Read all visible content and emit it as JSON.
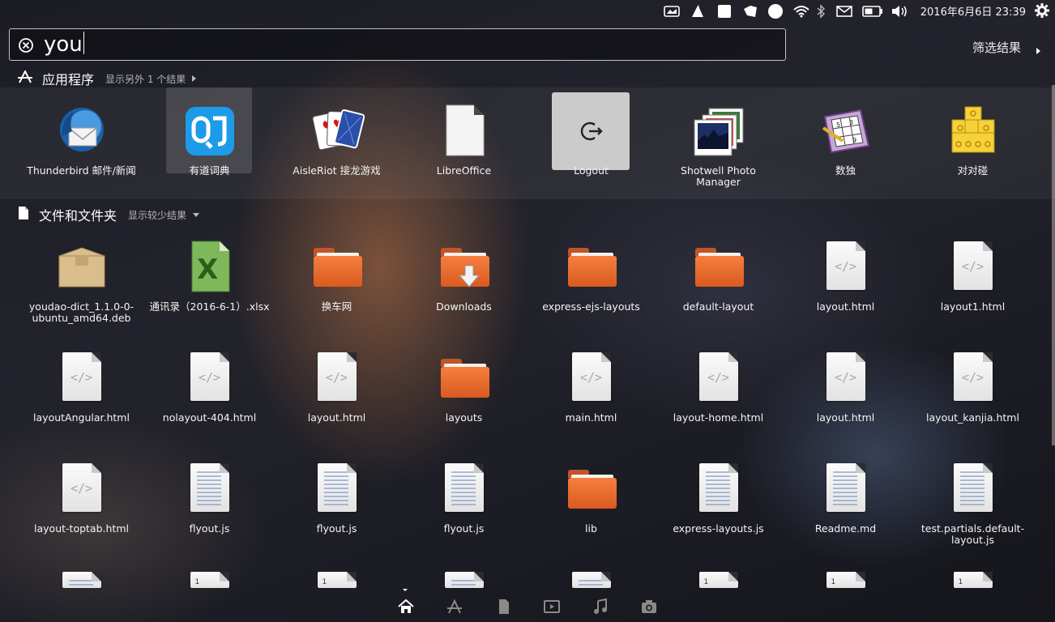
{
  "panel": {
    "clock": "2016年6月6日 23:39",
    "tray_icons": [
      "keyboard-indicator-icon",
      "app-indicator-icon",
      "app-indicator-2-icon",
      "app-indicator-3-icon",
      "circle-indicator-icon",
      "wifi-icon",
      "bluetooth-icon",
      "mail-icon",
      "battery-icon",
      "volume-icon"
    ]
  },
  "search": {
    "query": "you",
    "filter_label": "筛选结果"
  },
  "apps": {
    "title": "应用程序",
    "more": "显示另外 1 个结果",
    "items": [
      {
        "label": "Thunderbird 邮件/新闻",
        "icon": "thunderbird-icon"
      },
      {
        "label": "有道词典",
        "icon": "youdao-dict-icon"
      },
      {
        "label": "AisleRiot 接龙游戏",
        "icon": "aisleriot-cards-icon"
      },
      {
        "label": "LibreOffice",
        "icon": "libreoffice-icon"
      },
      {
        "label": "Logout",
        "icon": "logout-icon"
      },
      {
        "label": "Shotwell Photo Manager",
        "icon": "shotwell-icon"
      },
      {
        "label": "数独",
        "icon": "sudoku-icon"
      },
      {
        "label": "对对碰",
        "icon": "mahjongg-icon"
      }
    ]
  },
  "files": {
    "title": "文件和文件夹",
    "more": "显示较少结果",
    "items": [
      {
        "label": "youdao-dict_1.1.0-0-ubuntu_amd64.deb",
        "type": "package"
      },
      {
        "label": "通讯录（2016-6-1）.xlsx",
        "type": "spreadsheet"
      },
      {
        "label": "换车网",
        "type": "folder"
      },
      {
        "label": "Downloads",
        "type": "downloads-folder"
      },
      {
        "label": "express-ejs-layouts",
        "type": "folder"
      },
      {
        "label": "default-layout",
        "type": "folder"
      },
      {
        "label": "layout.html",
        "type": "html"
      },
      {
        "label": "layout1.html",
        "type": "html"
      },
      {
        "label": "layoutAngular.html",
        "type": "html"
      },
      {
        "label": "nolayout-404.html",
        "type": "html"
      },
      {
        "label": "layout.html",
        "type": "html"
      },
      {
        "label": "layouts",
        "type": "folder"
      },
      {
        "label": "main.html",
        "type": "html"
      },
      {
        "label": "layout-home.html",
        "type": "html"
      },
      {
        "label": "layout.html",
        "type": "html"
      },
      {
        "label": "layout_kanjia.html",
        "type": "html"
      },
      {
        "label": "layout-toptab.html",
        "type": "html"
      },
      {
        "label": "flyout.js",
        "type": "js"
      },
      {
        "label": "flyout.js",
        "type": "js"
      },
      {
        "label": "flyout.js",
        "type": "js"
      },
      {
        "label": "lib",
        "type": "folder"
      },
      {
        "label": "express-layouts.js",
        "type": "js"
      },
      {
        "label": "Readme.md",
        "type": "text"
      },
      {
        "label": "test.partials.default-layout.js",
        "type": "js"
      }
    ],
    "partial_number": "1"
  },
  "lenses": [
    "home-lens-icon",
    "applications-lens-icon",
    "files-lens-icon",
    "video-lens-icon",
    "music-lens-icon",
    "photo-lens-icon"
  ]
}
